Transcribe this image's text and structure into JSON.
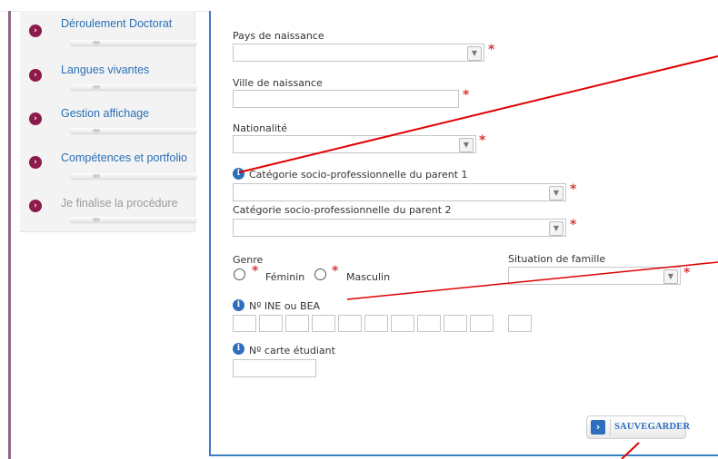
{
  "sidebar": {
    "items": [
      {
        "label": "Déroulement Doctorat",
        "enabled": true
      },
      {
        "label": "Langues vivantes",
        "enabled": true
      },
      {
        "label": "Gestion affichage",
        "enabled": true
      },
      {
        "label": "Compétences et portfolio",
        "enabled": true
      },
      {
        "label": "Je finalise la procédure",
        "enabled": false
      }
    ]
  },
  "form": {
    "pays_naissance": {
      "label": "Pays de naissance",
      "value": ""
    },
    "ville_naissance": {
      "label": "Ville de naissance",
      "value": ""
    },
    "nationalite": {
      "label": "Nationalité",
      "value": ""
    },
    "cat_parent1": {
      "label": "Catégorie socio-professionnelle du parent 1",
      "value": ""
    },
    "cat_parent2": {
      "label": "Catégorie socio-professionnelle du parent 2",
      "value": ""
    },
    "genre": {
      "label": "Genre",
      "options": [
        "Féminin",
        "Masculin"
      ]
    },
    "situation_famille": {
      "label": "Situation de famille",
      "value": ""
    },
    "ine": {
      "label": "Nº INE ou BEA"
    },
    "carte_etudiant": {
      "label": "Nº carte étudiant",
      "value": ""
    },
    "required_mark": "*"
  },
  "actions": {
    "save_label": "SAUVEGARDER"
  },
  "colors": {
    "annotation": "#e00000",
    "accent": "#2f6ebd",
    "required": "#d43b3b"
  }
}
